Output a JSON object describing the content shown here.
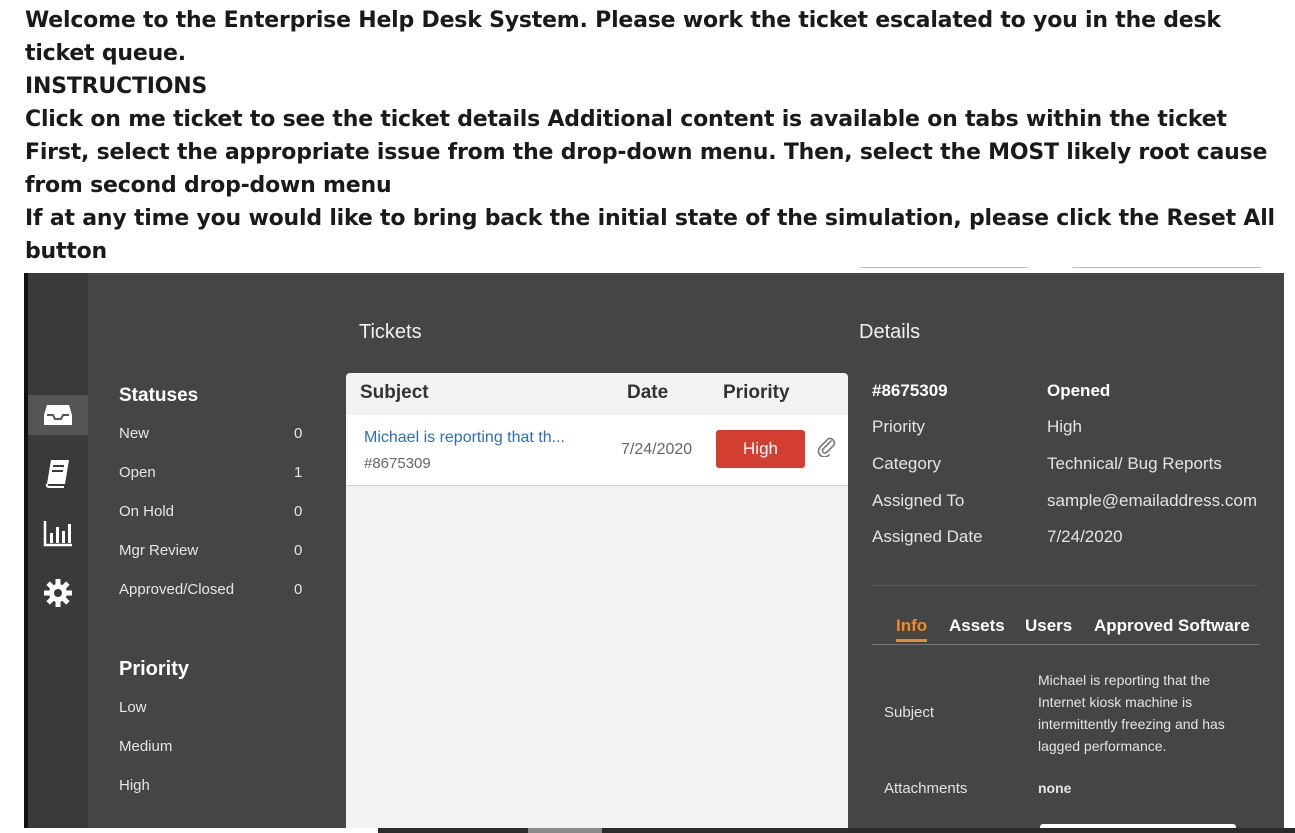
{
  "intro": {
    "line1": "Welcome to the Enterprise Help Desk System. Please work the ticket escalated to you in the desk ticket queue.",
    "line2": "INSTRUCTIONS",
    "line3": "Click on me ticket to see the ticket details Additional content is available on tabs within the ticket",
    "line4": "First, select the appropriate issue from the drop-down menu. Then, select the MOST likely root cause from second drop-down menu",
    "line5": "If at any time you would like to bring back the initial state of the simulation, please click the Reset All button"
  },
  "rail": {
    "icons": [
      "inbox-icon",
      "book-icon",
      "bar-chart-icon",
      "gear-icon"
    ]
  },
  "sidebar": {
    "statuses_heading": "Statuses",
    "statuses": [
      {
        "label": "New",
        "count": "0"
      },
      {
        "label": "Open",
        "count": "1"
      },
      {
        "label": "On Hold",
        "count": "0"
      },
      {
        "label": "Mgr Review",
        "count": "0"
      },
      {
        "label": "Approved/Closed",
        "count": "0"
      }
    ],
    "priority_heading": "Priority",
    "priorities": [
      "Low",
      "Medium",
      "High"
    ]
  },
  "tickets": {
    "title": "Tickets",
    "columns": {
      "subject": "Subject",
      "date": "Date",
      "priority": "Priority"
    },
    "rows": [
      {
        "subject": "Michael is reporting that th...",
        "number": "#8675309",
        "date": "7/24/2020",
        "priority": "High"
      }
    ]
  },
  "details": {
    "title": "Details",
    "ticket_number": "#8675309",
    "status": "Opened",
    "fields": [
      {
        "label": "Priority",
        "value": "High"
      },
      {
        "label": "Category",
        "value": "Technical/ Bug Reports"
      },
      {
        "label": "Assigned To",
        "value": "sample@emailaddress.com"
      },
      {
        "label": "Assigned Date",
        "value": "7/24/2020"
      }
    ],
    "tabs": [
      "Info",
      "Assets",
      "Users",
      "Approved Software"
    ],
    "active_tab": "Info",
    "info": {
      "subject_label": "Subject",
      "subject_text": "Michael is reporting that the Internet kiosk machine is intermittently freezing and has lagged performance.",
      "attachments_label": "Attachments",
      "attachments_value": "none"
    }
  },
  "colors": {
    "app_bg": "#454545",
    "priority_high": "#d23f31",
    "link": "#2e6fb3",
    "active_tab": "#f08a24"
  }
}
